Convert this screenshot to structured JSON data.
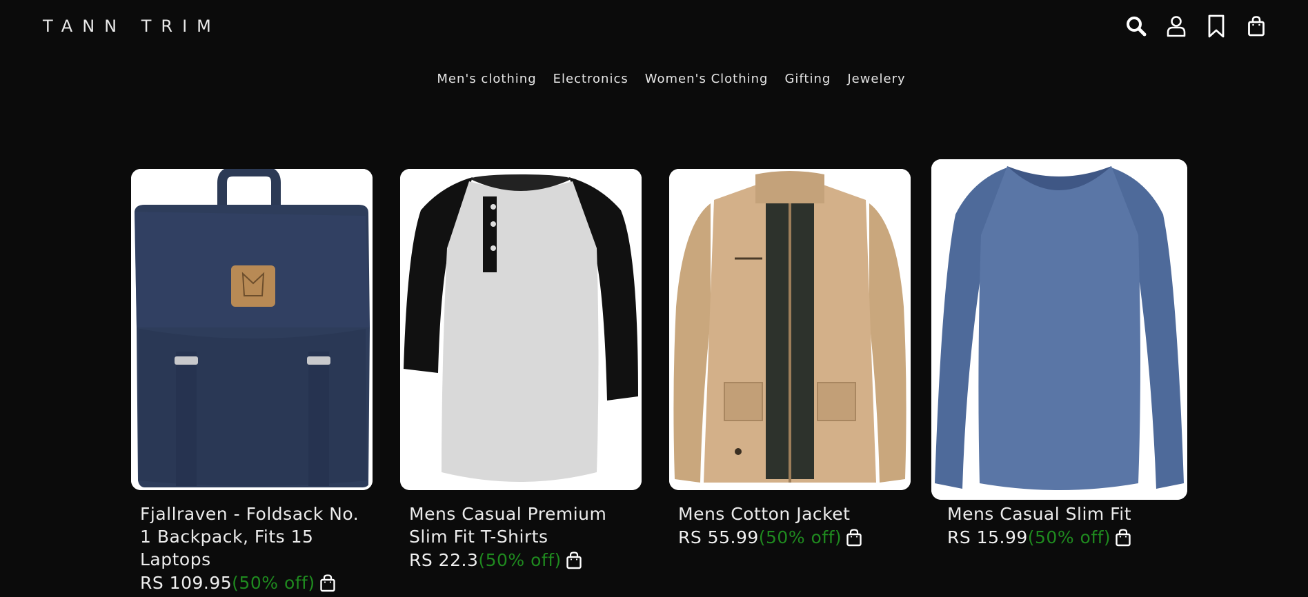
{
  "brand": {
    "name": "TANN TRIM"
  },
  "header": {
    "icons": [
      "search-icon",
      "user-icon",
      "bookmark-icon",
      "bag-icon"
    ]
  },
  "nav": {
    "items": [
      {
        "label": "Men's clothing"
      },
      {
        "label": "Electronics"
      },
      {
        "label": "Women's Clothing"
      },
      {
        "label": "Gifting"
      },
      {
        "label": "Jewelery"
      }
    ]
  },
  "products": [
    {
      "title": "Fjallraven - Foldsack No. 1 Backpack, Fits 15 Laptops",
      "price": "RS 109.95",
      "discount": "(50% off)",
      "image": "backpack"
    },
    {
      "title": "Mens Casual Premium Slim Fit T-Shirts",
      "price": "RS 22.3",
      "discount": "(50% off)",
      "image": "tshirt"
    },
    {
      "title": "Mens Cotton Jacket",
      "price": "RS 55.99",
      "discount": "(50% off)",
      "image": "jacket"
    },
    {
      "title": "Mens Casual Slim Fit",
      "price": "RS 15.99",
      "discount": "(50% off)",
      "image": "longsleeve"
    }
  ],
  "colors": {
    "background": "#0b0b0b",
    "text": "#e9e9e9",
    "discount": "#1f8a1f",
    "card": "#ffffff"
  }
}
